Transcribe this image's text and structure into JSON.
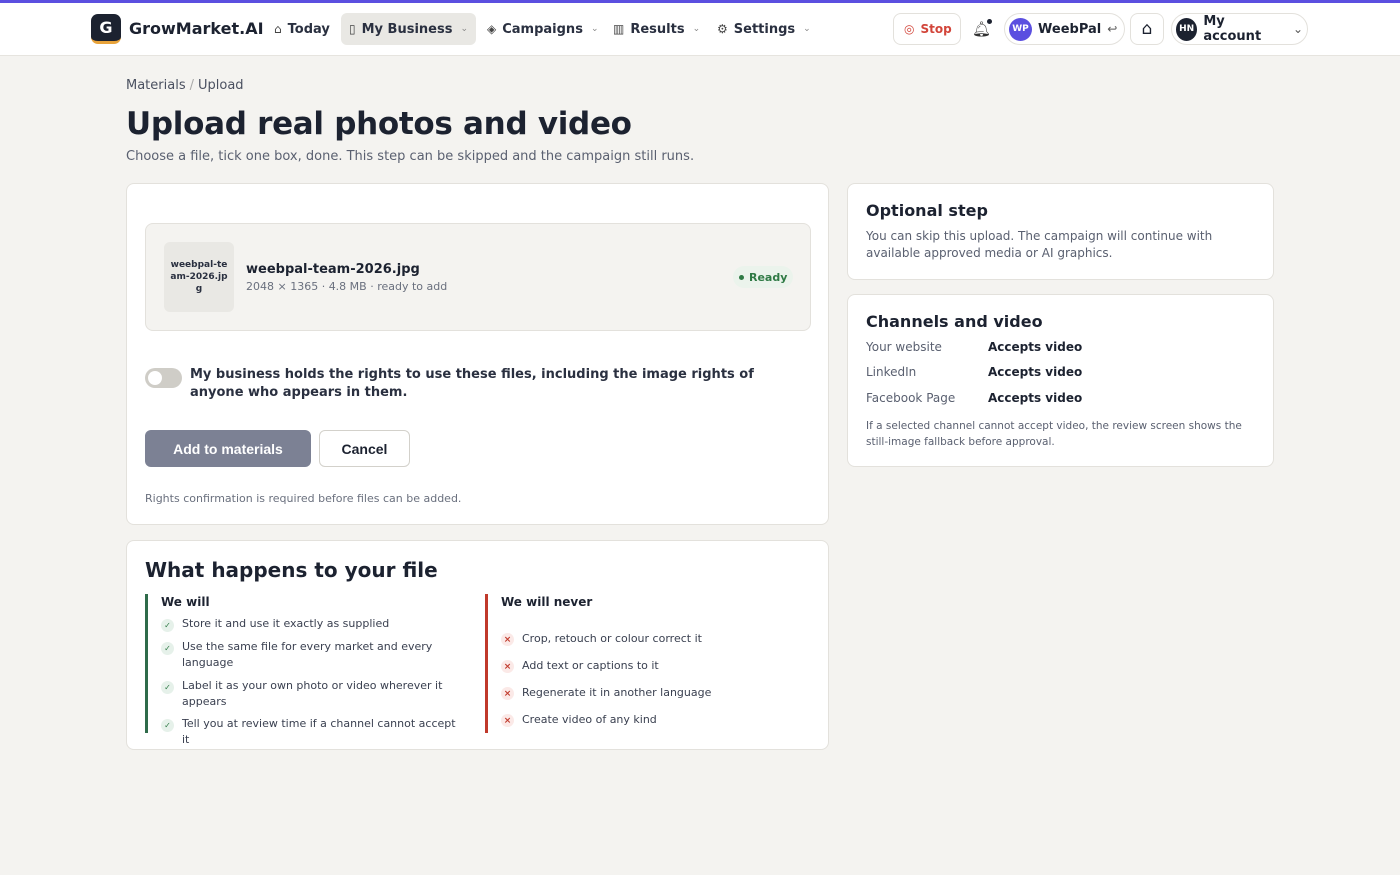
{
  "brand": {
    "logo_letter": "G",
    "name": "GrowMarket.AI",
    "accent": "#5b4fe0"
  },
  "nav": [
    {
      "label": "Today",
      "icon": "inbox-icon",
      "glyph": "▭",
      "chevron": false
    },
    {
      "label": "My Business",
      "icon": "tablet-icon",
      "glyph": "▯",
      "chevron": true,
      "active": true
    },
    {
      "label": "Campaigns",
      "icon": "layers-icon",
      "glyph": "◈",
      "chevron": true
    },
    {
      "label": "Results",
      "icon": "bar-chart-icon",
      "glyph": "📊",
      "chevron": true
    },
    {
      "label": "Settings",
      "icon": "gear-icon",
      "glyph": "⚙",
      "chevron": true
    }
  ],
  "header_actions": {
    "stop_label": "Stop",
    "workspace_initials": "WP",
    "workspace_name": "WeebPal",
    "account_initials": "HN",
    "account_label": "My account"
  },
  "breadcrumb": [
    "Materials",
    "Upload"
  ],
  "page": {
    "title": "Upload real photos and video",
    "subtitle": "Choose a file, tick one box, done. This step can be skipped and the campaign still runs."
  },
  "upload": {
    "thumb_label": "weebpal-team-2026.jpg",
    "file_name": "weebpal-team-2026.jpg",
    "file_meta": "2048 × 1365 · 4.8 MB · ready to add",
    "status": "Ready",
    "rights_label": "My business holds the rights to use these files, including the image rights of anyone who appears in them.",
    "rights_checked": false,
    "add_label": "Add to materials",
    "cancel_label": "Cancel",
    "hint": "Rights confirmation is required before files can be added."
  },
  "what_happens": {
    "title": "What happens to your file",
    "will_title": "We will",
    "will": [
      "Store it and use it exactly as supplied",
      "Use the same file for every market and every language",
      "Label it as your own photo or video wherever it appears",
      "Tell you at review time if a channel cannot accept it"
    ],
    "never_title": "We will never",
    "never": [
      "Crop, retouch or colour correct it",
      "Add text or captions to it",
      "Regenerate it in another language",
      "Create video of any kind"
    ]
  },
  "optional": {
    "title": "Optional step",
    "text": "You can skip this upload. The campaign will continue with available approved media or AI graphics."
  },
  "channels": {
    "title": "Channels and video",
    "rows": [
      {
        "name": "Your website",
        "value": "Accepts video"
      },
      {
        "name": "LinkedIn",
        "value": "Accepts video"
      },
      {
        "name": "Facebook Page",
        "value": "Accepts video"
      }
    ],
    "note": "If a selected channel cannot accept video, the review screen shows the still-image fallback before approval."
  }
}
